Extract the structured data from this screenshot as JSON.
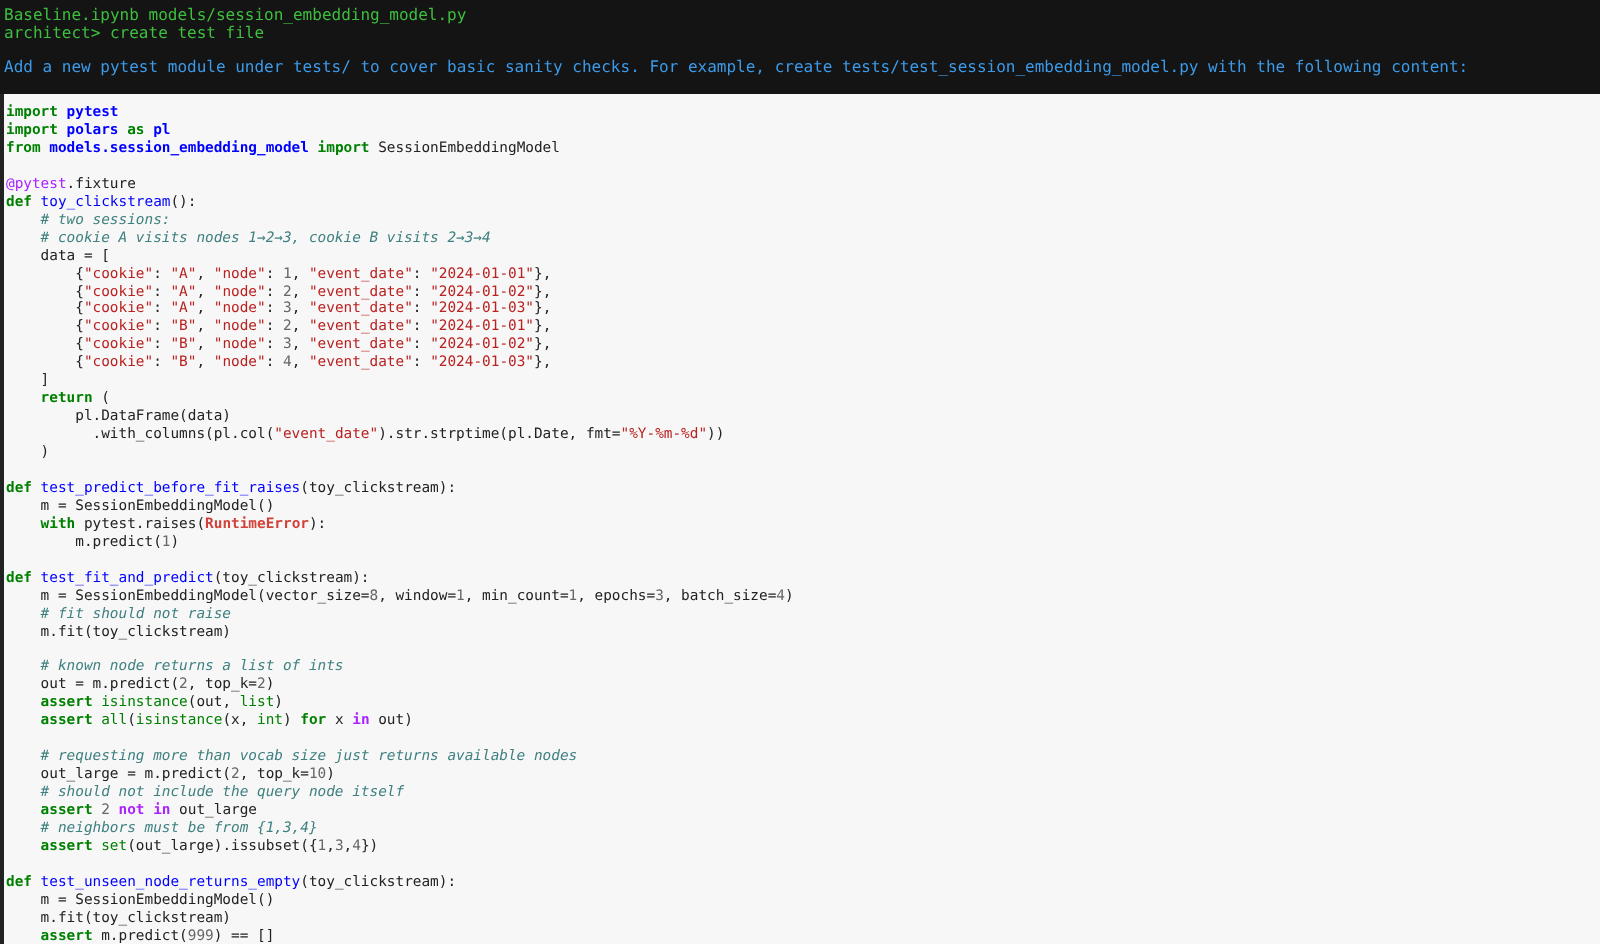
{
  "terminal": {
    "context": "Baseline.ipynb models/session_embedding_model.py",
    "command": "architect> create test file",
    "response": "Add a new pytest module under tests/ to cover basic sanity checks. For example, create tests/test_session_embedding_model.py with the following content:"
  },
  "code": {
    "blocks": [
      {
        "lines": [
          [
            {
              "kind": "kw",
              "text": "import"
            },
            {
              "kind": "ns",
              "text": " pytest"
            }
          ],
          [
            {
              "kind": "kw",
              "text": "import"
            },
            {
              "kind": "ns",
              "text": " polars"
            },
            {
              "kind": "kw",
              "text": " as"
            },
            {
              "kind": "ns",
              "text": " pl"
            }
          ],
          [
            {
              "kind": "kw",
              "text": "from"
            },
            {
              "kind": "ns",
              "text": " models.session_embedding_model"
            },
            {
              "kind": "kw",
              "text": " import"
            },
            {
              "kind": "plain",
              "text": " SessionEmbeddingModel"
            }
          ]
        ]
      },
      {
        "lines": [
          [
            {
              "kind": "deco",
              "text": "@pytest"
            },
            {
              "kind": "plain",
              "text": ".fixture"
            }
          ],
          [
            {
              "kind": "kw",
              "text": "def"
            },
            {
              "kind": "fn",
              "text": " toy_clickstream"
            },
            {
              "kind": "plain",
              "text": "():"
            }
          ],
          [
            {
              "kind": "com",
              "text": "    # two sessions:"
            }
          ],
          [
            {
              "kind": "com",
              "text": "    # cookie A visits nodes 1→2→3, cookie B visits 2→3→4"
            }
          ],
          [
            {
              "kind": "plain",
              "text": "    data = ["
            }
          ],
          [
            {
              "kind": "plain",
              "text": "        {"
            },
            {
              "kind": "str",
              "text": "\"cookie\""
            },
            {
              "kind": "plain",
              "text": ": "
            },
            {
              "kind": "str",
              "text": "\"A\""
            },
            {
              "kind": "plain",
              "text": ", "
            },
            {
              "kind": "str",
              "text": "\"node\""
            },
            {
              "kind": "plain",
              "text": ": "
            },
            {
              "kind": "num",
              "text": "1"
            },
            {
              "kind": "plain",
              "text": ", "
            },
            {
              "kind": "str",
              "text": "\"event_date\""
            },
            {
              "kind": "plain",
              "text": ": "
            },
            {
              "kind": "str",
              "text": "\"2024-01-01\""
            },
            {
              "kind": "plain",
              "text": "},"
            }
          ],
          [
            {
              "kind": "plain",
              "text": "        {"
            },
            {
              "kind": "str",
              "text": "\"cookie\""
            },
            {
              "kind": "plain",
              "text": ": "
            },
            {
              "kind": "str",
              "text": "\"A\""
            },
            {
              "kind": "plain",
              "text": ", "
            },
            {
              "kind": "str",
              "text": "\"node\""
            },
            {
              "kind": "plain",
              "text": ": "
            },
            {
              "kind": "num",
              "text": "2"
            },
            {
              "kind": "plain",
              "text": ", "
            },
            {
              "kind": "str",
              "text": "\"event_date\""
            },
            {
              "kind": "plain",
              "text": ": "
            },
            {
              "kind": "str",
              "text": "\"2024-01-02\""
            },
            {
              "kind": "plain",
              "text": "},"
            }
          ],
          [
            {
              "kind": "plain",
              "text": "        {"
            },
            {
              "kind": "str",
              "text": "\"cookie\""
            },
            {
              "kind": "plain",
              "text": ": "
            },
            {
              "kind": "str",
              "text": "\"A\""
            },
            {
              "kind": "plain",
              "text": ", "
            },
            {
              "kind": "str",
              "text": "\"node\""
            },
            {
              "kind": "plain",
              "text": ": "
            },
            {
              "kind": "num",
              "text": "3"
            },
            {
              "kind": "plain",
              "text": ", "
            },
            {
              "kind": "str",
              "text": "\"event_date\""
            },
            {
              "kind": "plain",
              "text": ": "
            },
            {
              "kind": "str",
              "text": "\"2024-01-03\""
            },
            {
              "kind": "plain",
              "text": "},"
            }
          ],
          [
            {
              "kind": "plain",
              "text": "        {"
            },
            {
              "kind": "str",
              "text": "\"cookie\""
            },
            {
              "kind": "plain",
              "text": ": "
            },
            {
              "kind": "str",
              "text": "\"B\""
            },
            {
              "kind": "plain",
              "text": ", "
            },
            {
              "kind": "str",
              "text": "\"node\""
            },
            {
              "kind": "plain",
              "text": ": "
            },
            {
              "kind": "num",
              "text": "2"
            },
            {
              "kind": "plain",
              "text": ", "
            },
            {
              "kind": "str",
              "text": "\"event_date\""
            },
            {
              "kind": "plain",
              "text": ": "
            },
            {
              "kind": "str",
              "text": "\"2024-01-01\""
            },
            {
              "kind": "plain",
              "text": "},"
            }
          ],
          [
            {
              "kind": "plain",
              "text": "        {"
            },
            {
              "kind": "str",
              "text": "\"cookie\""
            },
            {
              "kind": "plain",
              "text": ": "
            },
            {
              "kind": "str",
              "text": "\"B\""
            },
            {
              "kind": "plain",
              "text": ", "
            },
            {
              "kind": "str",
              "text": "\"node\""
            },
            {
              "kind": "plain",
              "text": ": "
            },
            {
              "kind": "num",
              "text": "3"
            },
            {
              "kind": "plain",
              "text": ", "
            },
            {
              "kind": "str",
              "text": "\"event_date\""
            },
            {
              "kind": "plain",
              "text": ": "
            },
            {
              "kind": "str",
              "text": "\"2024-01-02\""
            },
            {
              "kind": "plain",
              "text": "},"
            }
          ],
          [
            {
              "kind": "plain",
              "text": "        {"
            },
            {
              "kind": "str",
              "text": "\"cookie\""
            },
            {
              "kind": "plain",
              "text": ": "
            },
            {
              "kind": "str",
              "text": "\"B\""
            },
            {
              "kind": "plain",
              "text": ", "
            },
            {
              "kind": "str",
              "text": "\"node\""
            },
            {
              "kind": "plain",
              "text": ": "
            },
            {
              "kind": "num",
              "text": "4"
            },
            {
              "kind": "plain",
              "text": ", "
            },
            {
              "kind": "str",
              "text": "\"event_date\""
            },
            {
              "kind": "plain",
              "text": ": "
            },
            {
              "kind": "str",
              "text": "\"2024-01-03\""
            },
            {
              "kind": "plain",
              "text": "},"
            }
          ],
          [
            {
              "kind": "plain",
              "text": "    ]"
            }
          ],
          [
            {
              "kind": "kw",
              "text": "    return"
            },
            {
              "kind": "plain",
              "text": " ("
            }
          ],
          [
            {
              "kind": "plain",
              "text": "        pl.DataFrame(data)"
            }
          ],
          [
            {
              "kind": "plain",
              "text": "          .with_columns(pl.col("
            },
            {
              "kind": "str",
              "text": "\"event_date\""
            },
            {
              "kind": "plain",
              "text": ").str.strptime(pl.Date, fmt="
            },
            {
              "kind": "str",
              "text": "\"%Y-%m-%d\""
            },
            {
              "kind": "plain",
              "text": "))"
            }
          ],
          [
            {
              "kind": "plain",
              "text": "    )"
            }
          ]
        ]
      },
      {
        "lines": [
          [
            {
              "kind": "kw",
              "text": "def"
            },
            {
              "kind": "fn",
              "text": " test_predict_before_fit_raises"
            },
            {
              "kind": "plain",
              "text": "(toy_clickstream):"
            }
          ],
          [
            {
              "kind": "plain",
              "text": "    m = SessionEmbeddingModel()"
            }
          ],
          [
            {
              "kind": "kw",
              "text": "    with"
            },
            {
              "kind": "plain",
              "text": " pytest.raises("
            },
            {
              "kind": "exc",
              "text": "RuntimeError"
            },
            {
              "kind": "plain",
              "text": "):"
            }
          ],
          [
            {
              "kind": "plain",
              "text": "        m.predict("
            },
            {
              "kind": "num",
              "text": "1"
            },
            {
              "kind": "plain",
              "text": ")"
            }
          ]
        ]
      },
      {
        "lines": [
          [
            {
              "kind": "kw",
              "text": "def"
            },
            {
              "kind": "fn",
              "text": " test_fit_and_predict"
            },
            {
              "kind": "plain",
              "text": "(toy_clickstream):"
            }
          ],
          [
            {
              "kind": "plain",
              "text": "    m = SessionEmbeddingModel(vector_size="
            },
            {
              "kind": "num",
              "text": "8"
            },
            {
              "kind": "plain",
              "text": ", window="
            },
            {
              "kind": "num",
              "text": "1"
            },
            {
              "kind": "plain",
              "text": ", min_count="
            },
            {
              "kind": "num",
              "text": "1"
            },
            {
              "kind": "plain",
              "text": ", epochs="
            },
            {
              "kind": "num",
              "text": "3"
            },
            {
              "kind": "plain",
              "text": ", batch_size="
            },
            {
              "kind": "num",
              "text": "4"
            },
            {
              "kind": "plain",
              "text": ")"
            }
          ],
          [
            {
              "kind": "com",
              "text": "    # fit should not raise"
            }
          ],
          [
            {
              "kind": "plain",
              "text": "    m.fit(toy_clickstream)"
            }
          ]
        ]
      },
      {
        "lines": [
          [
            {
              "kind": "com",
              "text": "    # known node returns a list of ints"
            }
          ],
          [
            {
              "kind": "plain",
              "text": "    out = m.predict("
            },
            {
              "kind": "num",
              "text": "2"
            },
            {
              "kind": "plain",
              "text": ", top_k="
            },
            {
              "kind": "num",
              "text": "2"
            },
            {
              "kind": "plain",
              "text": ")"
            }
          ],
          [
            {
              "kind": "kw",
              "text": "    assert"
            },
            {
              "kind": "builtin",
              "text": " isinstance"
            },
            {
              "kind": "plain",
              "text": "(out, "
            },
            {
              "kind": "builtin",
              "text": "list"
            },
            {
              "kind": "plain",
              "text": ")"
            }
          ],
          [
            {
              "kind": "kw",
              "text": "    assert"
            },
            {
              "kind": "builtin",
              "text": " all"
            },
            {
              "kind": "plain",
              "text": "("
            },
            {
              "kind": "builtin",
              "text": "isinstance"
            },
            {
              "kind": "plain",
              "text": "(x, "
            },
            {
              "kind": "builtin",
              "text": "int"
            },
            {
              "kind": "plain",
              "text": ") "
            },
            {
              "kind": "kw",
              "text": "for"
            },
            {
              "kind": "plain",
              "text": " x "
            },
            {
              "kind": "opword",
              "text": "in"
            },
            {
              "kind": "plain",
              "text": " out)"
            }
          ]
        ]
      },
      {
        "lines": [
          [
            {
              "kind": "com",
              "text": "    # requesting more than vocab size just returns available nodes"
            }
          ],
          [
            {
              "kind": "plain",
              "text": "    out_large = m.predict("
            },
            {
              "kind": "num",
              "text": "2"
            },
            {
              "kind": "plain",
              "text": ", top_k="
            },
            {
              "kind": "num",
              "text": "10"
            },
            {
              "kind": "plain",
              "text": ")"
            }
          ],
          [
            {
              "kind": "com",
              "text": "    # should not include the query node itself"
            }
          ],
          [
            {
              "kind": "kw",
              "text": "    assert"
            },
            {
              "kind": "num",
              "text": " 2"
            },
            {
              "kind": "opword",
              "text": " not"
            },
            {
              "kind": "opword",
              "text": " in"
            },
            {
              "kind": "plain",
              "text": " out_large"
            }
          ],
          [
            {
              "kind": "com",
              "text": "    # neighbors must be from {1,3,4}"
            }
          ],
          [
            {
              "kind": "kw",
              "text": "    assert"
            },
            {
              "kind": "builtin",
              "text": " set"
            },
            {
              "kind": "plain",
              "text": "(out_large).issubset({"
            },
            {
              "kind": "num",
              "text": "1"
            },
            {
              "kind": "plain",
              "text": ","
            },
            {
              "kind": "num",
              "text": "3"
            },
            {
              "kind": "plain",
              "text": ","
            },
            {
              "kind": "num",
              "text": "4"
            },
            {
              "kind": "plain",
              "text": "})"
            }
          ]
        ]
      },
      {
        "lines": [
          [
            {
              "kind": "kw",
              "text": "def"
            },
            {
              "kind": "fn",
              "text": " test_unseen_node_returns_empty"
            },
            {
              "kind": "plain",
              "text": "(toy_clickstream):"
            }
          ],
          [
            {
              "kind": "plain",
              "text": "    m = SessionEmbeddingModel()"
            }
          ],
          [
            {
              "kind": "plain",
              "text": "    m.fit(toy_clickstream)"
            }
          ],
          [
            {
              "kind": "kw",
              "text": "    assert"
            },
            {
              "kind": "plain",
              "text": " m.predict("
            },
            {
              "kind": "num",
              "text": "999"
            },
            {
              "kind": "plain",
              "text": ") == []"
            }
          ]
        ]
      }
    ]
  }
}
